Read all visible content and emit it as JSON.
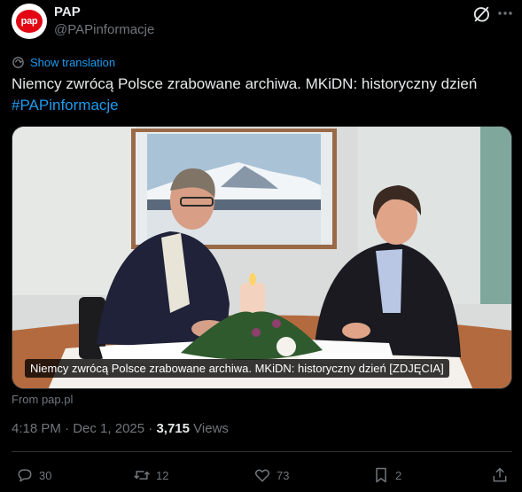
{
  "author": {
    "avatar_text": "pap",
    "name": "PAP",
    "handle": "@PAPinformacje"
  },
  "translate_label": "Show translation",
  "tweet": {
    "text": "Niemcy zwrócą Polsce zrabowane archiwa. MKiDN: historyczny dzień",
    "hashtag": "#PAPinformacje"
  },
  "media": {
    "caption": "Niemcy zwrócą Polsce zrabowane archiwa. MKiDN: historyczny dzień [ZDJĘCIA]",
    "source": "From pap.pl"
  },
  "meta": {
    "time": "4:18 PM",
    "separator": " · ",
    "date": "Dec 1, 2025",
    "views_count": "3,715",
    "views_label": "Views"
  },
  "actions": {
    "replies": "30",
    "reposts": "12",
    "likes": "73",
    "bookmarks": "2"
  },
  "colors": {
    "background": "#000000",
    "text": "#e7e9ea",
    "secondary": "#71767b",
    "link": "#1d9bf0",
    "brand_red": "#e30613"
  }
}
